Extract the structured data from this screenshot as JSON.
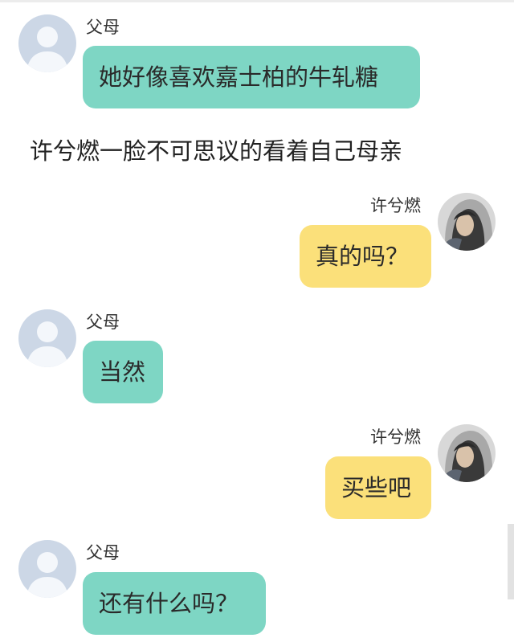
{
  "messages": [
    {
      "sender": "父母",
      "text": "她好像喜欢嘉士柏的牛轧糖",
      "side": "left",
      "avatar_icon": "default-user-avatar"
    },
    {
      "narration": "许兮燃一脸不可思议的看着自己母亲"
    },
    {
      "sender": "许兮燃",
      "text": "真的吗？",
      "side": "right",
      "avatar_icon": "hooded-person-photo"
    },
    {
      "sender": "父母",
      "text": "当然",
      "side": "left",
      "avatar_icon": "default-user-avatar"
    },
    {
      "sender": "许兮燃",
      "text": "买些吧",
      "side": "right",
      "avatar_icon": "hooded-person-photo"
    },
    {
      "sender": "父母",
      "text": "还有什么吗？",
      "side": "left",
      "avatar_icon": "default-user-avatar"
    }
  ],
  "colors": {
    "left_bubble": "#7ed6c4",
    "right_bubble": "#fbe07a",
    "default_avatar_bg": "#ccd7e6"
  }
}
